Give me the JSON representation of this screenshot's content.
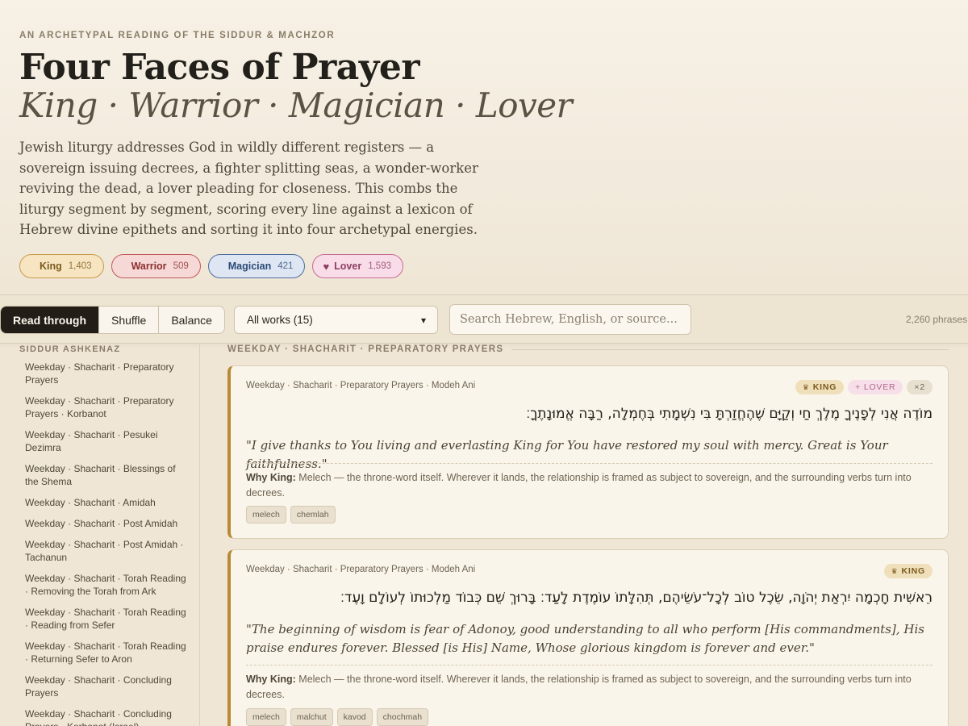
{
  "header": {
    "eyebrow": "AN ARCHETYPAL READING OF THE SIDDUR & MACHZOR",
    "title": "Four Faces of Prayer",
    "subtitle": "King · Warrior · Magician · Lover",
    "intro": "Jewish liturgy addresses God in wildly different registers — a sovereign issuing decrees, a fighter splitting seas, a wonder-worker reviving the dead, a lover pleading for closeness. This combs the liturgy segment by segment, scoring every line against a lexicon of Hebrew divine epithets and sorting it into four archetypal energies."
  },
  "archetypes": [
    {
      "label": "King",
      "count": "1,403",
      "color": "#c89b4e"
    },
    {
      "label": "Warrior",
      "count": "509",
      "color": "#c2585a"
    },
    {
      "label": "Magician",
      "count": "421",
      "color": "#4d6d9e"
    },
    {
      "label": "Lover",
      "count": "1,593",
      "color": "#c56d95",
      "icon": "heart-icon"
    }
  ],
  "toolbar": {
    "modes": [
      "Read through",
      "Shuffle",
      "Balance"
    ],
    "active_mode": "Read through",
    "works_selected": "All works (15)",
    "search_placeholder": "Search Hebrew, English, or source...",
    "phrase_count": "2,260 phrases"
  },
  "sidebar": {
    "heading": "SIDDUR ASHKENAZ",
    "items": [
      "Weekday · Shacharit · Preparatory Prayers",
      "Weekday · Shacharit · Preparatory Prayers · Korbanot",
      "Weekday · Shacharit · Pesukei Dezimra",
      "Weekday · Shacharit · Blessings of the Shema",
      "Weekday · Shacharit · Amidah",
      "Weekday · Shacharit · Post Amidah",
      "Weekday · Shacharit · Post Amidah · Tachanun",
      "Weekday · Shacharit · Torah Reading · Removing the Torah from Ark",
      "Weekday · Shacharit · Torah Reading · Reading from Sefer",
      "Weekday · Shacharit · Torah Reading · Returning Sefer to Aron",
      "Weekday · Shacharit · Concluding Prayers",
      "Weekday · Shacharit · Concluding Prayers · Korbanot (Israel)"
    ]
  },
  "main": {
    "section_heading": "WEEKDAY · SHACHARIT · PREPARATORY PRAYERS",
    "cards": [
      {
        "crumb": "Weekday · Shacharit · Preparatory Prayers · Modeh Ani",
        "tags": [
          "KING",
          "+ LOVER",
          "×2"
        ],
        "hebrew": "מוֹדֶה אֲנִי לְפָנֶיךָ מֶלֶךְ חַי וְקַיָּם שֶׁהֶחֱזַרְתָּ בִּי נִשְׁמָתִי בְּחֶמְלָה, רַבָּה אֱמוּנָתֶךָ׃",
        "english": "\"I give thanks to You living and everlasting King for You have restored my soul with mercy. Great is Your faithfulness.\"",
        "why_label": "Why King:",
        "why_text": "Melech — the throne-word itself. Wherever it lands, the relationship is framed as subject to sovereign, and the surrounding verbs turn into decrees.",
        "chips": [
          "melech",
          "chemlah"
        ]
      },
      {
        "crumb": "Weekday · Shacharit · Preparatory Prayers · Modeh Ani",
        "tags": [
          "KING"
        ],
        "hebrew": "רֵאשִׁית חָכְמָה יִרְאַת יְהֹוָה, שֵׂכֶל טוֹב לְכָל־עֹשֵׂיהֶם, תְּהִלָּתוֹ עוֹמֶדֶת לָעַד׃ בָּרוּךְ שֵׁם כְּבוֹד מַלְכוּתוֹ לְעוֹלָם וָעֶד׃",
        "english": "\"The beginning of wisdom is fear of Adonoy, good understanding to all who perform [His commandments], His praise endures forever. Blessed [is His] Name, Whose glorious kingdom is forever and ever.\"",
        "why_label": "Why King:",
        "why_text": "Melech — the throne-word itself. Wherever it lands, the relationship is framed as subject to sovereign, and the surrounding verbs turn into decrees.",
        "chips": [
          "melech",
          "malchut",
          "kavod",
          "chochmah"
        ]
      }
    ]
  }
}
